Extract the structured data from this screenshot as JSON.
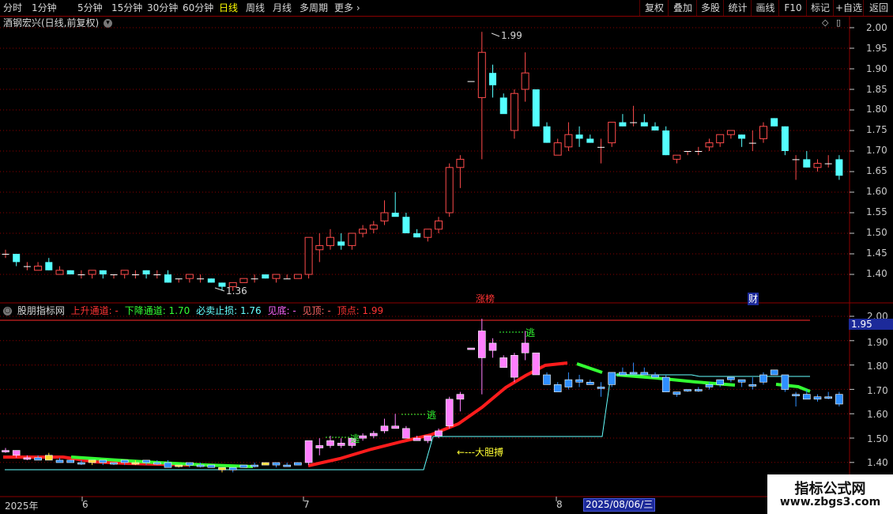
{
  "toolbar": {
    "periods": [
      "分时",
      "1分钟",
      "5分钟",
      "15分钟",
      "30分钟",
      "60分钟",
      "日线",
      "周线",
      "月线",
      "多周期",
      "更多"
    ],
    "active_period": "日线",
    "more_arrow": "›",
    "right_buttons": [
      "复权",
      "叠加",
      "多股",
      "统计",
      "画线",
      "F10",
      "标记",
      "+自选",
      "返回"
    ]
  },
  "main": {
    "stock_label": "酒钢宏兴(日线,前复权)",
    "y_ticks": [
      "2.00",
      "1.95",
      "1.90",
      "1.85",
      "1.80",
      "1.75",
      "1.70",
      "1.65",
      "1.60",
      "1.55",
      "1.50",
      "1.45",
      "1.40"
    ],
    "high_marker": "1.99",
    "low_marker": "1.36",
    "zhang_badge": "涨榜",
    "cai_badge": "财"
  },
  "indicator": {
    "name": "股朋指标网",
    "items": [
      {
        "label": "上升通道: -",
        "color": "#ff3333"
      },
      {
        "label": "下降通道: 1.70",
        "color": "#33ff33"
      },
      {
        "label": "必卖止损: 1.76",
        "color": "#66ffff"
      },
      {
        "label": "见底: -",
        "color": "#ff66ff"
      },
      {
        "label": "见顶: -",
        "color": "#ff6666"
      },
      {
        "label": "顶点: 1.99",
        "color": "#ff3333"
      }
    ],
    "y_ticks": [
      "2.00",
      "1.90",
      "1.80",
      "1.70",
      "1.60",
      "1.50",
      "1.40"
    ],
    "current_value": "1.95",
    "escape_label": "逃",
    "bold_label": "←---大胆搏"
  },
  "x_axis": {
    "labels": [
      "2025年",
      "6",
      "7",
      "8"
    ],
    "crosshair_date": "2025/08/06/三"
  },
  "watermark": {
    "title": "指标公式网",
    "url": "www.zbgs3.com"
  },
  "colors": {
    "up": "#ff4b4b",
    "down": "#54ffff",
    "grid": "#8b0000",
    "rise_line": "#ff1c1c",
    "fall_line": "#33ff33",
    "stop_line": "#66ffff",
    "pink": "#ff7fff",
    "blue": "#2f8fff"
  },
  "chart_data": {
    "type": "candlestick",
    "ylim": [
      1.38,
      2.0
    ],
    "series": [
      {
        "ohlc": [
          [
            1.45,
            1.46,
            1.44,
            1.45
          ],
          [
            1.45,
            1.45,
            1.42,
            1.43
          ],
          [
            1.42,
            1.43,
            1.41,
            1.42
          ],
          [
            1.41,
            1.43,
            1.41,
            1.42
          ],
          [
            1.43,
            1.44,
            1.41,
            1.41
          ],
          [
            1.4,
            1.42,
            1.4,
            1.41
          ],
          [
            1.41,
            1.41,
            1.4,
            1.4
          ],
          [
            1.4,
            1.41,
            1.39,
            1.4
          ],
          [
            1.4,
            1.41,
            1.39,
            1.41
          ],
          [
            1.41,
            1.41,
            1.39,
            1.4
          ],
          [
            1.4,
            1.4,
            1.39,
            1.4
          ],
          [
            1.4,
            1.41,
            1.39,
            1.41
          ],
          [
            1.4,
            1.41,
            1.39,
            1.4
          ],
          [
            1.41,
            1.41,
            1.39,
            1.4
          ],
          [
            1.4,
            1.41,
            1.39,
            1.4
          ],
          [
            1.4,
            1.41,
            1.38,
            1.38
          ],
          [
            1.39,
            1.39,
            1.38,
            1.39
          ],
          [
            1.39,
            1.4,
            1.38,
            1.4
          ],
          [
            1.39,
            1.4,
            1.38,
            1.39
          ],
          [
            1.39,
            1.39,
            1.38,
            1.38
          ],
          [
            1.38,
            1.38,
            1.36,
            1.37
          ],
          [
            1.37,
            1.38,
            1.36,
            1.38
          ],
          [
            1.38,
            1.39,
            1.38,
            1.39
          ],
          [
            1.39,
            1.4,
            1.38,
            1.39
          ],
          [
            1.4,
            1.4,
            1.39,
            1.39
          ],
          [
            1.39,
            1.4,
            1.38,
            1.4
          ],
          [
            1.39,
            1.4,
            1.39,
            1.39
          ],
          [
            1.39,
            1.4,
            1.39,
            1.4
          ],
          [
            1.4,
            1.49,
            1.39,
            1.49
          ],
          [
            1.46,
            1.5,
            1.43,
            1.47
          ],
          [
            1.47,
            1.51,
            1.46,
            1.49
          ],
          [
            1.48,
            1.5,
            1.46,
            1.47
          ],
          [
            1.47,
            1.5,
            1.46,
            1.5
          ],
          [
            1.5,
            1.52,
            1.49,
            1.51
          ],
          [
            1.51,
            1.53,
            1.5,
            1.52
          ],
          [
            1.53,
            1.58,
            1.52,
            1.55
          ],
          [
            1.55,
            1.6,
            1.55,
            1.54
          ],
          [
            1.54,
            1.55,
            1.5,
            1.5
          ],
          [
            1.5,
            1.51,
            1.49,
            1.49
          ],
          [
            1.49,
            1.51,
            1.48,
            1.51
          ],
          [
            1.51,
            1.54,
            1.5,
            1.53
          ],
          [
            1.55,
            1.67,
            1.54,
            1.66
          ],
          [
            1.66,
            1.69,
            1.61,
            1.68
          ],
          [
            1.87,
            1.87,
            1.87,
            1.87
          ],
          [
            1.83,
            1.99,
            1.68,
            1.94
          ],
          [
            1.89,
            1.91,
            1.83,
            1.86
          ],
          [
            1.83,
            1.84,
            1.8,
            1.79
          ],
          [
            1.75,
            1.85,
            1.73,
            1.84
          ],
          [
            1.85,
            1.94,
            1.82,
            1.89
          ],
          [
            1.85,
            1.85,
            1.76,
            1.76
          ],
          [
            1.76,
            1.77,
            1.72,
            1.72
          ],
          [
            1.69,
            1.73,
            1.69,
            1.72
          ],
          [
            1.71,
            1.77,
            1.7,
            1.74
          ],
          [
            1.74,
            1.76,
            1.71,
            1.73
          ],
          [
            1.73,
            1.74,
            1.72,
            1.72
          ],
          [
            1.71,
            1.73,
            1.67,
            1.71
          ],
          [
            1.72,
            1.77,
            1.71,
            1.77
          ],
          [
            1.77,
            1.79,
            1.76,
            1.76
          ],
          [
            1.77,
            1.81,
            1.76,
            1.77
          ],
          [
            1.77,
            1.79,
            1.76,
            1.76
          ],
          [
            1.76,
            1.77,
            1.75,
            1.75
          ],
          [
            1.75,
            1.76,
            1.69,
            1.69
          ],
          [
            1.68,
            1.69,
            1.67,
            1.69
          ],
          [
            1.7,
            1.7,
            1.69,
            1.7
          ],
          [
            1.7,
            1.71,
            1.69,
            1.7
          ],
          [
            1.71,
            1.73,
            1.7,
            1.72
          ],
          [
            1.72,
            1.74,
            1.71,
            1.74
          ],
          [
            1.74,
            1.75,
            1.73,
            1.75
          ],
          [
            1.74,
            1.74,
            1.71,
            1.73
          ],
          [
            1.72,
            1.75,
            1.7,
            1.72
          ],
          [
            1.73,
            1.77,
            1.72,
            1.76
          ],
          [
            1.78,
            1.78,
            1.76,
            1.76
          ],
          [
            1.76,
            1.76,
            1.69,
            1.7
          ],
          [
            1.68,
            1.69,
            1.63,
            1.68
          ],
          [
            1.68,
            1.7,
            1.66,
            1.66
          ],
          [
            1.66,
            1.68,
            1.65,
            1.67
          ],
          [
            1.67,
            1.69,
            1.66,
            1.67
          ],
          [
            1.68,
            1.69,
            1.63,
            1.64
          ]
        ]
      }
    ]
  }
}
